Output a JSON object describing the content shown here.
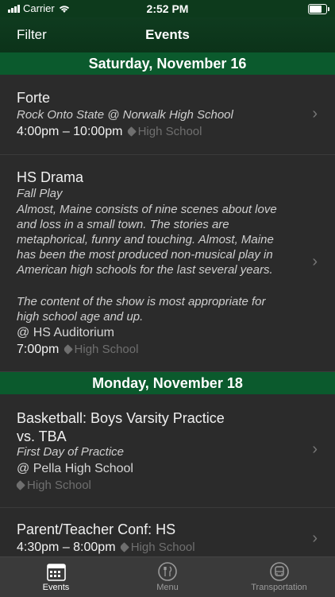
{
  "status": {
    "carrier": "Carrier",
    "time": "2:52 PM"
  },
  "nav": {
    "filter": "Filter",
    "title": "Events"
  },
  "sections": [
    {
      "header": "Saturday, November 16",
      "events": [
        {
          "title": "Forte",
          "subtitle": "Rock Onto State @ Norwalk High School",
          "time": "4:00pm – 10:00pm",
          "tag": "High School"
        },
        {
          "title": "HS Drama",
          "subtitle": "Fall Play",
          "description_lines": [
            "Almost, Maine consists of nine scenes about love",
            "and loss in a small town. The stories are",
            "metaphorical, funny and touching. Almost, Maine",
            "has been the most produced non-musical play in",
            "American high schools for the last several years.",
            "",
            "The content of the show is most appropriate for",
            "high school age and up."
          ],
          "location": "@ HS Auditorium",
          "time": "7:00pm",
          "tag": "High School"
        }
      ]
    },
    {
      "header": "Monday, November 18",
      "events": [
        {
          "title": "Basketball: Boys Varsity Practice",
          "title2": "vs. TBA",
          "subtitle": "First Day of Practice",
          "location": "@ Pella High School",
          "tag": "High School"
        },
        {
          "title": "Parent/Teacher Conf: HS",
          "time": "4:30pm – 8:00pm",
          "tag": "High School"
        }
      ]
    }
  ],
  "tabs": [
    {
      "label": "Events",
      "icon": "calendar-icon"
    },
    {
      "label": "Menu",
      "icon": "utensils-icon"
    },
    {
      "label": "Transportation",
      "icon": "bus-icon"
    }
  ]
}
